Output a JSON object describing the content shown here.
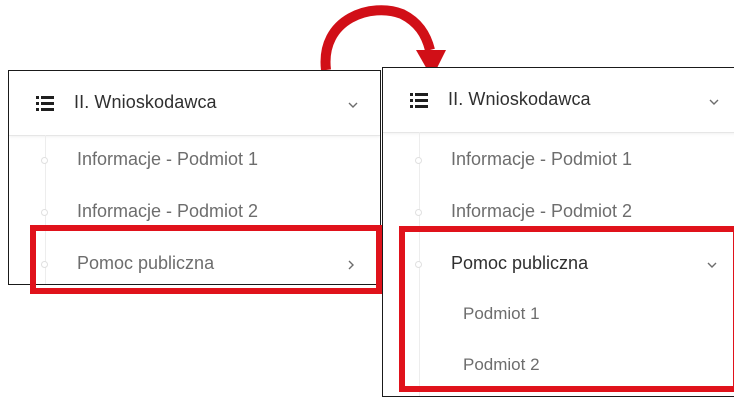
{
  "before": {
    "header_title": "II. Wnioskodawca",
    "items": [
      {
        "label": "Informacje - Podmiot 1"
      },
      {
        "label": "Informacje - Podmiot 2"
      },
      {
        "label": "Pomoc publiczna"
      }
    ]
  },
  "after": {
    "header_title": "II. Wnioskodawca",
    "items": [
      {
        "label": "Informacje - Podmiot 1"
      },
      {
        "label": "Informacje - Podmiot 2"
      },
      {
        "label": "Pomoc publiczna"
      }
    ],
    "subitems": [
      {
        "label": "Podmiot 1"
      },
      {
        "label": "Podmiot 2"
      }
    ]
  },
  "icons": {
    "header": "list-icon",
    "expand_collapsed": "chevron-down-icon",
    "item_collapsed": "chevron-right-icon",
    "item_expanded": "chevron-down-icon",
    "transition": "curved-arrow-icon"
  },
  "colors": {
    "highlight": "#e0121b",
    "arrow": "#d10f17",
    "text_active": "#2f2f2f",
    "text_muted": "#6d6d6d"
  }
}
